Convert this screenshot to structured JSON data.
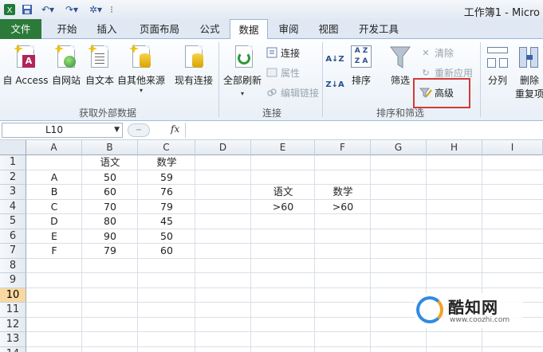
{
  "window": {
    "title": "工作簿1 - Micro"
  },
  "tabs": [
    {
      "label": "文件"
    },
    {
      "label": "开始"
    },
    {
      "label": "插入"
    },
    {
      "label": "页面布局"
    },
    {
      "label": "公式"
    },
    {
      "label": "数据"
    },
    {
      "label": "审阅"
    },
    {
      "label": "视图"
    },
    {
      "label": "开发工具"
    }
  ],
  "ribbon": {
    "external": {
      "label": "获取外部数据",
      "access": "自 Access",
      "web": "自网站",
      "text": "自文本",
      "other": "自其他来源",
      "existing": "现有连接"
    },
    "connections": {
      "label": "连接",
      "refresh_all": "全部刷新",
      "connections": "连接",
      "properties": "属性",
      "edit_links": "编辑链接"
    },
    "sortfilter": {
      "label": "排序和筛选",
      "sort": "排序",
      "filter": "筛选",
      "clear": "清除",
      "reapply": "重新应用",
      "advanced": "高级"
    },
    "datatools": {
      "split": "分列",
      "remove": "删除",
      "remove2": "重复项"
    }
  },
  "formula_bar": {
    "name_box": "L10",
    "fx": "fx",
    "formula": ""
  },
  "columns": [
    "A",
    "B",
    "C",
    "D",
    "E",
    "F",
    "G",
    "H",
    "I"
  ],
  "rows": [
    "1",
    "2",
    "3",
    "4",
    "5",
    "6",
    "7",
    "8",
    "9",
    "10",
    "11",
    "12",
    "13",
    "14"
  ],
  "cells": {
    "B1": "语文",
    "C1": "数学",
    "A2": "A",
    "B2": "50",
    "C2": "59",
    "A3": "B",
    "B3": "60",
    "C3": "76",
    "A4": "C",
    "B4": "70",
    "C4": "79",
    "A5": "D",
    "B5": "80",
    "C5": "45",
    "A6": "E",
    "B6": "90",
    "C6": "50",
    "A7": "F",
    "B7": "79",
    "C7": "60",
    "E3": "语文",
    "F3": "数学",
    "E4": ">60",
    "F4": ">60"
  },
  "selected_row": "10",
  "watermark": {
    "name": "酷知网",
    "url": "www.coozhi.com"
  }
}
